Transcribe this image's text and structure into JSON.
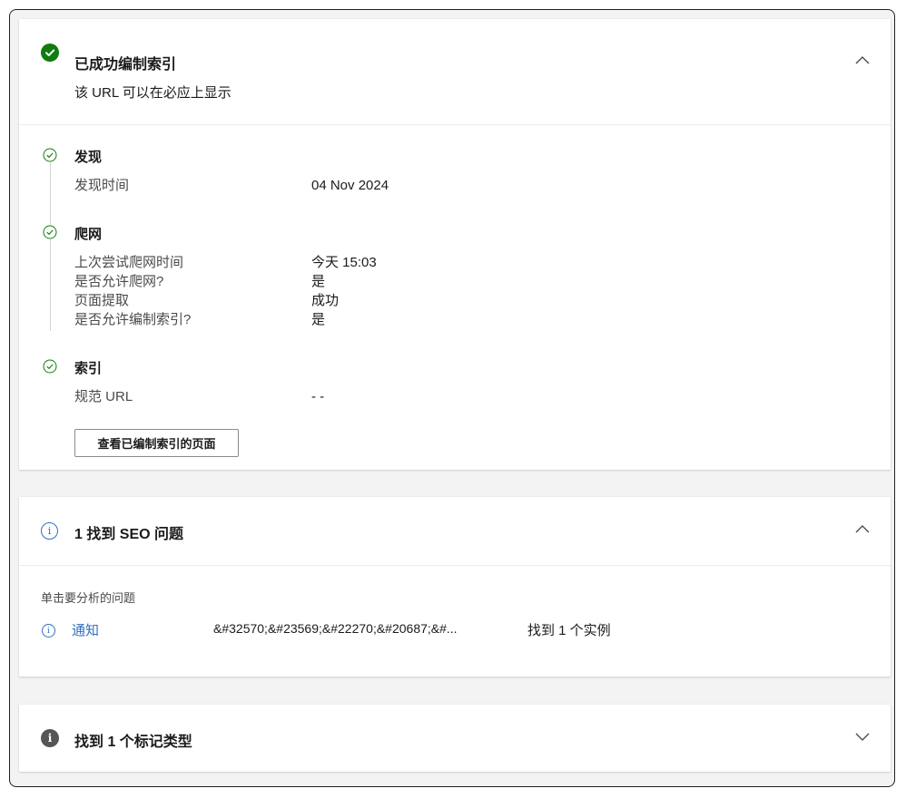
{
  "indexing_card": {
    "title": "已成功编制索引",
    "subtitle": "该 URL 可以在必应上显示",
    "collapse_icon": "chevron-up-icon",
    "status_color": "#107c10",
    "steps": [
      {
        "title": "发现",
        "rows": [
          {
            "label": "发现时间",
            "value": "04 Nov 2024"
          }
        ]
      },
      {
        "title": "爬网",
        "rows": [
          {
            "label": "上次尝试爬网时间",
            "value": "今天 15:03"
          },
          {
            "label": "是否允许爬网?",
            "value": "是"
          },
          {
            "label": "页面提取",
            "value": "成功"
          },
          {
            "label": "是否允许编制索引?",
            "value": "是"
          }
        ]
      },
      {
        "title": "索引",
        "rows": [
          {
            "label": "规范 URL",
            "value": "- -"
          }
        ]
      }
    ],
    "view_button_label": "查看已编制索引的页面"
  },
  "seo_card": {
    "title": "1 找到 SEO 问题",
    "collapse_icon": "chevron-up-icon",
    "hint": "单击要分析的问题",
    "issue": {
      "severity_label": "通知",
      "text": "&#32570;&#23569;&#22270;&#20687;&#...",
      "count_text": "找到 1 个实例"
    },
    "accent_color": "#2f6fc0"
  },
  "markup_card": {
    "title": "找到 1 个标记类型",
    "expand_icon": "chevron-down-icon"
  }
}
